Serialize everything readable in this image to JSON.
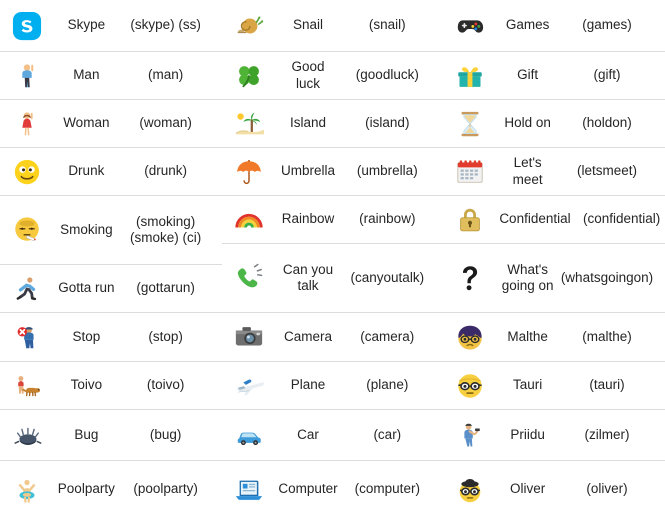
{
  "page": {
    "title": "Skype Emoticons Reference Table",
    "columns": 3,
    "text_color": "#262626",
    "divider_color": "#dcdcdc",
    "background": "#ffffff"
  },
  "columns": [
    {
      "id": "column-1",
      "rows": [
        {
          "icon": "skype-logo-icon",
          "glyph": "",
          "name": "Skype",
          "code": "(skype) (ss)"
        },
        {
          "icon": "man-icon",
          "glyph": "🙋‍♂️",
          "name": "Man",
          "code": "(man)"
        },
        {
          "icon": "woman-icon",
          "glyph": "🙋‍♀️",
          "name": "Woman",
          "code": "(woman)"
        },
        {
          "icon": "drunk-face-icon",
          "glyph": "😵",
          "name": "Drunk",
          "code": "(drunk)"
        },
        {
          "icon": "smoking-face-icon",
          "glyph": "🚬",
          "name": "Smoking",
          "code": "(smoking)\n(smoke) (ci)"
        },
        {
          "icon": "running-person-icon",
          "glyph": "🏃",
          "name": "Gotta run",
          "code": "(gottarun)"
        },
        {
          "icon": "stop-sign-person-icon",
          "glyph": "🛑",
          "name": "Stop",
          "code": "(stop)"
        },
        {
          "icon": "toivo-dog-icon",
          "glyph": "🐕",
          "name": "Toivo",
          "code": "(toivo)"
        },
        {
          "icon": "bug-icon",
          "glyph": "🐞",
          "name": "Bug",
          "code": "(bug)"
        },
        {
          "icon": "poolparty-icon",
          "glyph": "🏊",
          "name": "Poolparty",
          "code": "(poolparty)"
        }
      ]
    },
    {
      "id": "column-2",
      "rows": [
        {
          "icon": "snail-icon",
          "glyph": "🐌",
          "name": "Snail",
          "code": "(snail)"
        },
        {
          "icon": "clover-icon",
          "glyph": "🍀",
          "name": "Good luck",
          "code": "(goodluck)"
        },
        {
          "icon": "island-icon",
          "glyph": "🏝",
          "name": "Island",
          "code": "(island)"
        },
        {
          "icon": "umbrella-icon",
          "glyph": "☂",
          "name": "Umbrella",
          "code": "(umbrella)"
        },
        {
          "icon": "rainbow-icon",
          "glyph": "🌈",
          "name": "Rainbow",
          "code": "(rainbow)"
        },
        {
          "icon": "ringing-phone-icon",
          "glyph": "📞",
          "name": "Can you\ntalk",
          "code": "(canyoutalk)"
        },
        {
          "icon": "camera-icon",
          "glyph": "📷",
          "name": "Camera",
          "code": "(camera)"
        },
        {
          "icon": "plane-icon",
          "glyph": "✈",
          "name": "Plane",
          "code": "(plane)"
        },
        {
          "icon": "car-icon",
          "glyph": "🚗",
          "name": "Car",
          "code": "(car)"
        },
        {
          "icon": "computer-icon",
          "glyph": "💻",
          "name": "Computer",
          "code": "(computer)"
        }
      ]
    },
    {
      "id": "column-3",
      "rows": [
        {
          "icon": "gamepad-icon",
          "glyph": "🎮",
          "name": "Games",
          "code": "(games)"
        },
        {
          "icon": "gift-icon",
          "glyph": "🎁",
          "name": "Gift",
          "code": "(gift)"
        },
        {
          "icon": "hourglass-icon",
          "glyph": "⌛",
          "name": "Hold on",
          "code": "(holdon)"
        },
        {
          "icon": "calendar-icon",
          "glyph": "📅",
          "name": "Let's meet",
          "code": "(letsmeet)"
        },
        {
          "icon": "padlock-icon",
          "glyph": "🔒",
          "name": "Confidential",
          "code": "(confidential)"
        },
        {
          "icon": "question-mark-icon",
          "glyph": "❓",
          "name": "What's\ngoing on",
          "code": "(whatsgoingon)"
        },
        {
          "icon": "malthe-face-icon",
          "glyph": "🤓",
          "name": "Malthe",
          "code": "(malthe)"
        },
        {
          "icon": "tauri-face-icon",
          "glyph": "🤓",
          "name": "Tauri",
          "code": "(tauri)"
        },
        {
          "icon": "priidu-person-icon",
          "glyph": "🕺",
          "name": "Priidu",
          "code": "(zilmer)"
        },
        {
          "icon": "oliver-face-icon",
          "glyph": "🕵",
          "name": "Oliver",
          "code": "(oliver)"
        }
      ]
    }
  ]
}
